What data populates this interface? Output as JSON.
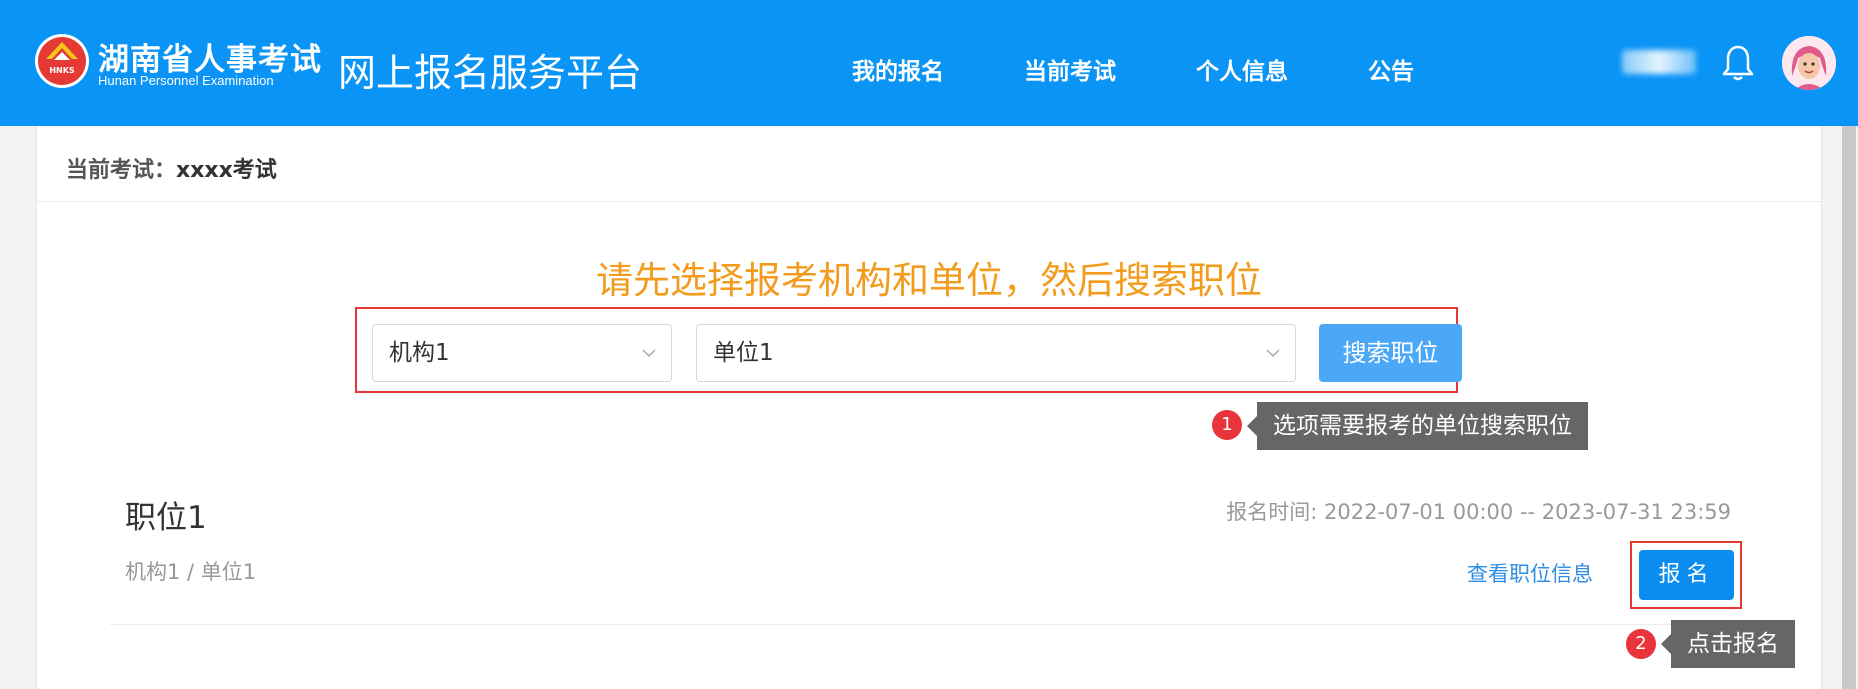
{
  "header": {
    "logo_badge": "HNKS",
    "logo_cn": "湖南省人事考试",
    "logo_en": "Hunan Personnel Examination",
    "platform_title": "网上报名服务平台",
    "nav": [
      "我的报名",
      "当前考试",
      "个人信息",
      "公告"
    ],
    "icons": {
      "notification": "bell-icon",
      "user": "avatar"
    }
  },
  "exam": {
    "label_key": "当前考试：",
    "label_value": "xxxx考试"
  },
  "search": {
    "instruction": "请先选择报考机构和单位，然后搜索职位",
    "org_value": "机构1",
    "unit_value": "单位1",
    "button": "搜索职位",
    "tip_number": "1",
    "tip_text": "选项需要报考的单位搜索职位"
  },
  "position": {
    "title": "职位1",
    "time": "报名时间: 2022-07-01 00:00 -- 2023-07-31 23:59",
    "org_path": "机构1 / 单位1",
    "view_link": "查看职位信息",
    "apply_button": "报名",
    "tip_number": "2",
    "tip_text": "点击报名"
  },
  "colors": {
    "header_bg": "#0a94f5",
    "accent_orange": "#f29b1d",
    "highlight_red": "#e53935",
    "primary_button": "#0a8cf0"
  }
}
